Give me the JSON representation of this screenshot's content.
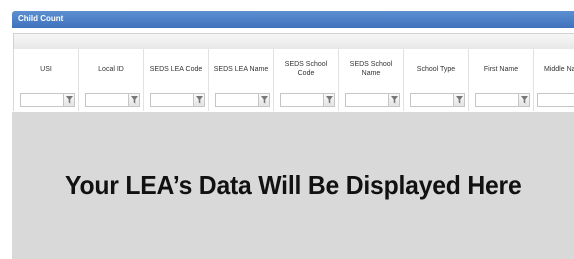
{
  "panel": {
    "title": "Child Count"
  },
  "columns": [
    {
      "label": "USI"
    },
    {
      "label": "Local ID"
    },
    {
      "label": "SEDS LEA Code"
    },
    {
      "label": "SEDS LEA Name"
    },
    {
      "label": "SEDS School Code"
    },
    {
      "label": "SEDS School Name"
    },
    {
      "label": "School Type"
    },
    {
      "label": "First Name"
    },
    {
      "label": "Middle Na"
    }
  ],
  "filter_icon": "filter-funnel-icon",
  "overlay": {
    "message": "Your LEA’s Data Will Be Displayed Here"
  },
  "colors": {
    "header_bar": "#3f72bc",
    "overlay_bg": "#d9d9d9"
  }
}
